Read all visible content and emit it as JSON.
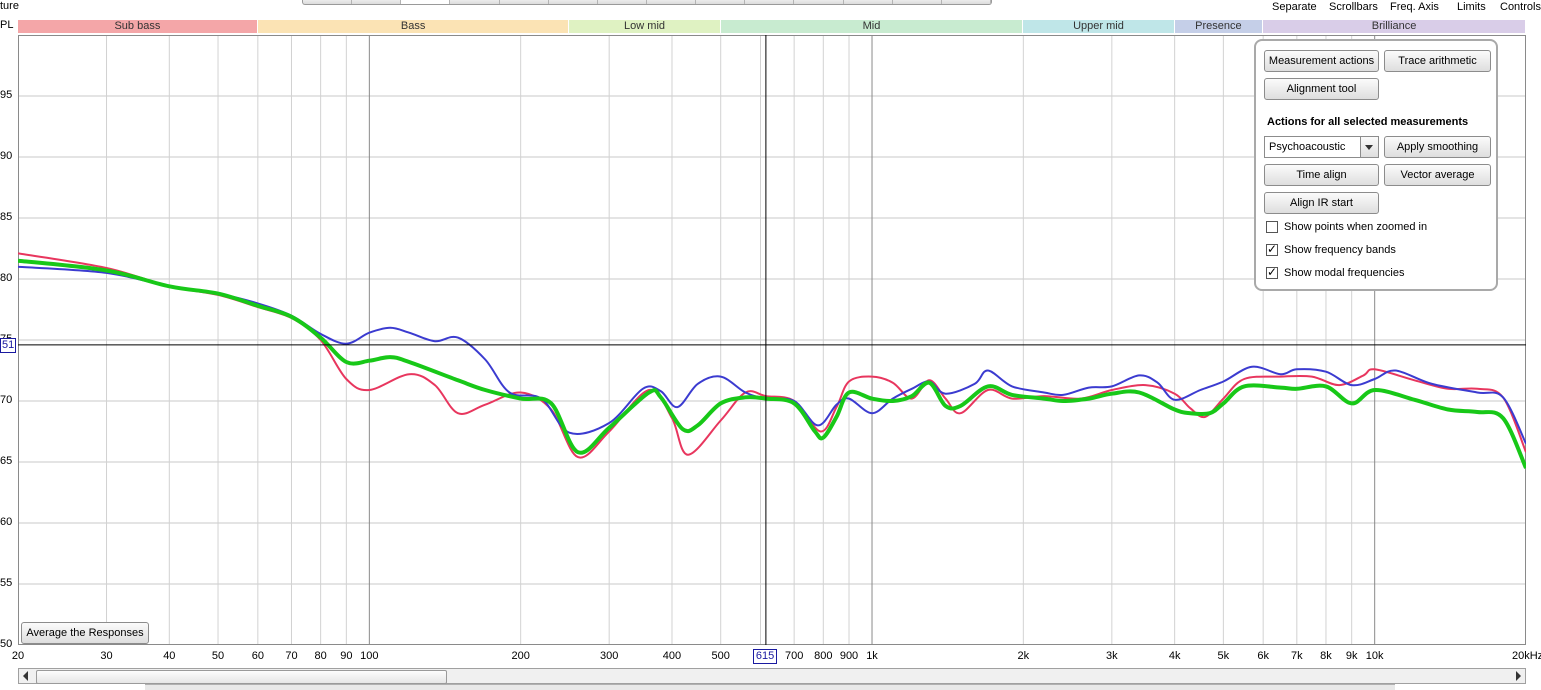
{
  "window": {
    "top_left_label": "ture",
    "y_unit_label": "PL"
  },
  "top_links": [
    "Separate",
    "Scrollbars",
    "Freq. Axis",
    "Limits",
    "Controls"
  ],
  "bands": [
    "Sub bass",
    "Bass",
    "Low mid",
    "Mid",
    "Upper mid",
    "Presence",
    "Brilliance"
  ],
  "band_colors": [
    "#f4a6a8",
    "#fbe3b4",
    "#dff2c2",
    "#c8ebd0",
    "#bfe6e8",
    "#c5cfe8",
    "#d9cde8"
  ],
  "panel": {
    "measurement_actions": "Measurement actions",
    "trace_arithmetic": "Trace arithmetic",
    "alignment_tool": "Alignment tool",
    "heading": "Actions for all selected measurements",
    "smoothing_value": "Psychoacoustic",
    "apply_smoothing": "Apply smoothing",
    "time_align": "Time align",
    "vector_average": "Vector average",
    "align_ir_start": "Align IR start",
    "checkboxes": [
      {
        "label": "Show points when zoomed in",
        "checked": false
      },
      {
        "label": "Show frequency bands",
        "checked": true
      },
      {
        "label": "Show modal frequencies",
        "checked": true
      }
    ]
  },
  "average_button": "Average the Responses",
  "cursor": {
    "x_readout": "615",
    "y_readout": "51"
  },
  "chart_data": {
    "type": "line",
    "x_scale": "log",
    "xlim": [
      20,
      20000
    ],
    "ylim": [
      50,
      100
    ],
    "y_ticks": [
      "50",
      "55",
      "60",
      "65",
      "70",
      "75",
      "80",
      "85",
      "90",
      "95"
    ],
    "x_ticks": [
      {
        "v": 20,
        "t": "20"
      },
      {
        "v": 30,
        "t": "30"
      },
      {
        "v": 40,
        "t": "40"
      },
      {
        "v": 50,
        "t": "50"
      },
      {
        "v": 60,
        "t": "60"
      },
      {
        "v": 70,
        "t": "70"
      },
      {
        "v": 80,
        "t": "80"
      },
      {
        "v": 90,
        "t": "90"
      },
      {
        "v": 100,
        "t": "100"
      },
      {
        "v": 200,
        "t": "200"
      },
      {
        "v": 300,
        "t": "300"
      },
      {
        "v": 400,
        "t": "400"
      },
      {
        "v": 500,
        "t": "500"
      },
      {
        "v": 700,
        "t": "700"
      },
      {
        "v": 800,
        "t": "800"
      },
      {
        "v": 900,
        "t": "900"
      },
      {
        "v": 1000,
        "t": "1k"
      },
      {
        "v": 2000,
        "t": "2k"
      },
      {
        "v": 3000,
        "t": "3k"
      },
      {
        "v": 4000,
        "t": "4k"
      },
      {
        "v": 5000,
        "t": "5k"
      },
      {
        "v": 6000,
        "t": "6k"
      },
      {
        "v": 7000,
        "t": "7k"
      },
      {
        "v": 8000,
        "t": "8k"
      },
      {
        "v": 9000,
        "t": "9k"
      },
      {
        "v": 10000,
        "t": "10k"
      },
      {
        "v": 20000,
        "t": "20kHz"
      }
    ],
    "band_edges": [
      20,
      60,
      250,
      500,
      2000,
      4000,
      6000,
      20000
    ],
    "cursor": {
      "x": 615,
      "y": 74.6
    },
    "series": [
      {
        "color": "#e8365e",
        "width": 2,
        "points": [
          [
            20,
            82.1
          ],
          [
            30,
            80.9
          ],
          [
            40,
            79.4
          ],
          [
            50,
            78.7
          ],
          [
            60,
            77.7
          ],
          [
            70,
            76.8
          ],
          [
            80,
            75
          ],
          [
            90,
            71.8
          ],
          [
            100,
            70.9
          ],
          [
            120,
            72.2
          ],
          [
            135,
            71.3
          ],
          [
            150,
            69
          ],
          [
            170,
            69.7
          ],
          [
            200,
            70.7
          ],
          [
            230,
            69.3
          ],
          [
            260,
            65.4
          ],
          [
            300,
            67.5
          ],
          [
            360,
            70.9
          ],
          [
            400,
            68.6
          ],
          [
            430,
            65.6
          ],
          [
            500,
            68.4
          ],
          [
            560,
            70.7
          ],
          [
            615,
            70.4
          ],
          [
            700,
            70
          ],
          [
            790,
            67.5
          ],
          [
            850,
            69.5
          ],
          [
            900,
            71.6
          ],
          [
            1000,
            72
          ],
          [
            1100,
            71.5
          ],
          [
            1200,
            70.2
          ],
          [
            1300,
            71.7
          ],
          [
            1400,
            70.2
          ],
          [
            1500,
            69
          ],
          [
            1700,
            70.9
          ],
          [
            1900,
            70.2
          ],
          [
            2200,
            70.4
          ],
          [
            2600,
            70.2
          ],
          [
            3000,
            70.9
          ],
          [
            3500,
            71.3
          ],
          [
            4000,
            70.6
          ],
          [
            4300,
            69.4
          ],
          [
            4600,
            68.7
          ],
          [
            5000,
            70.2
          ],
          [
            5500,
            71.8
          ],
          [
            6500,
            72
          ],
          [
            7500,
            72
          ],
          [
            8500,
            71.3
          ],
          [
            9500,
            72.1
          ],
          [
            10000,
            72.6
          ],
          [
            12000,
            71.7
          ],
          [
            14000,
            71
          ],
          [
            16000,
            71
          ],
          [
            18000,
            70.3
          ],
          [
            20000,
            65.8
          ]
        ]
      },
      {
        "color": "#3b3bd0",
        "width": 2,
        "points": [
          [
            20,
            81
          ],
          [
            30,
            80.5
          ],
          [
            40,
            79.4
          ],
          [
            50,
            78.8
          ],
          [
            60,
            78
          ],
          [
            70,
            77
          ],
          [
            80,
            75.5
          ],
          [
            90,
            74.7
          ],
          [
            100,
            75.6
          ],
          [
            110,
            76
          ],
          [
            120,
            75.6
          ],
          [
            135,
            74.9
          ],
          [
            150,
            75.2
          ],
          [
            170,
            73.4
          ],
          [
            190,
            70.7
          ],
          [
            220,
            70.2
          ],
          [
            250,
            67.4
          ],
          [
            300,
            68.2
          ],
          [
            350,
            71
          ],
          [
            380,
            70.8
          ],
          [
            410,
            69.5
          ],
          [
            450,
            71.4
          ],
          [
            500,
            72
          ],
          [
            560,
            70.7
          ],
          [
            615,
            70.2
          ],
          [
            700,
            70
          ],
          [
            780,
            68
          ],
          [
            850,
            69.7
          ],
          [
            900,
            70.2
          ],
          [
            1000,
            69
          ],
          [
            1100,
            70.2
          ],
          [
            1200,
            71
          ],
          [
            1300,
            71.6
          ],
          [
            1400,
            70.6
          ],
          [
            1600,
            71.4
          ],
          [
            1700,
            72.5
          ],
          [
            1900,
            71.2
          ],
          [
            2200,
            70.7
          ],
          [
            2400,
            70.5
          ],
          [
            2700,
            71.1
          ],
          [
            3000,
            71.2
          ],
          [
            3400,
            72.1
          ],
          [
            3700,
            71.5
          ],
          [
            4000,
            70.1
          ],
          [
            4500,
            70.9
          ],
          [
            5000,
            71.6
          ],
          [
            5700,
            72.8
          ],
          [
            6500,
            72.2
          ],
          [
            7000,
            72.6
          ],
          [
            8000,
            72.4
          ],
          [
            9000,
            71.3
          ],
          [
            10000,
            71.8
          ],
          [
            11000,
            72.5
          ],
          [
            13000,
            71.4
          ],
          [
            16000,
            70.7
          ],
          [
            18000,
            70.3
          ],
          [
            20000,
            66.5
          ]
        ]
      },
      {
        "color": "#18c818",
        "width": 4,
        "points": [
          [
            20,
            81.5
          ],
          [
            30,
            80.7
          ],
          [
            40,
            79.4
          ],
          [
            50,
            78.8
          ],
          [
            60,
            77.8
          ],
          [
            70,
            76.9
          ],
          [
            80,
            75.2
          ],
          [
            90,
            73.2
          ],
          [
            100,
            73.3
          ],
          [
            110,
            73.6
          ],
          [
            120,
            73.2
          ],
          [
            150,
            71.7
          ],
          [
            170,
            70.9
          ],
          [
            200,
            70.2
          ],
          [
            230,
            69.8
          ],
          [
            260,
            65.8
          ],
          [
            300,
            67.8
          ],
          [
            360,
            70.7
          ],
          [
            380,
            70.3
          ],
          [
            420,
            67.7
          ],
          [
            450,
            68
          ],
          [
            500,
            69.8
          ],
          [
            560,
            70.3
          ],
          [
            615,
            70.2
          ],
          [
            700,
            69.8
          ],
          [
            770,
            67.5
          ],
          [
            800,
            67
          ],
          [
            850,
            68.7
          ],
          [
            900,
            70.7
          ],
          [
            1000,
            70.2
          ],
          [
            1100,
            70
          ],
          [
            1200,
            70.4
          ],
          [
            1300,
            71.5
          ],
          [
            1400,
            69.6
          ],
          [
            1500,
            69.6
          ],
          [
            1700,
            71.2
          ],
          [
            1900,
            70.5
          ],
          [
            2200,
            70.2
          ],
          [
            2400,
            70
          ],
          [
            2700,
            70.2
          ],
          [
            3000,
            70.6
          ],
          [
            3400,
            70.7
          ],
          [
            4000,
            69.3
          ],
          [
            4300,
            69
          ],
          [
            4700,
            69
          ],
          [
            5000,
            69.8
          ],
          [
            5500,
            71.2
          ],
          [
            6500,
            71.1
          ],
          [
            7000,
            71
          ],
          [
            8000,
            71.2
          ],
          [
            9000,
            69.8
          ],
          [
            10000,
            70.9
          ],
          [
            12000,
            70.1
          ],
          [
            14000,
            69.3
          ],
          [
            16000,
            69.1
          ],
          [
            18000,
            68.6
          ],
          [
            20000,
            64.5
          ]
        ]
      }
    ]
  }
}
